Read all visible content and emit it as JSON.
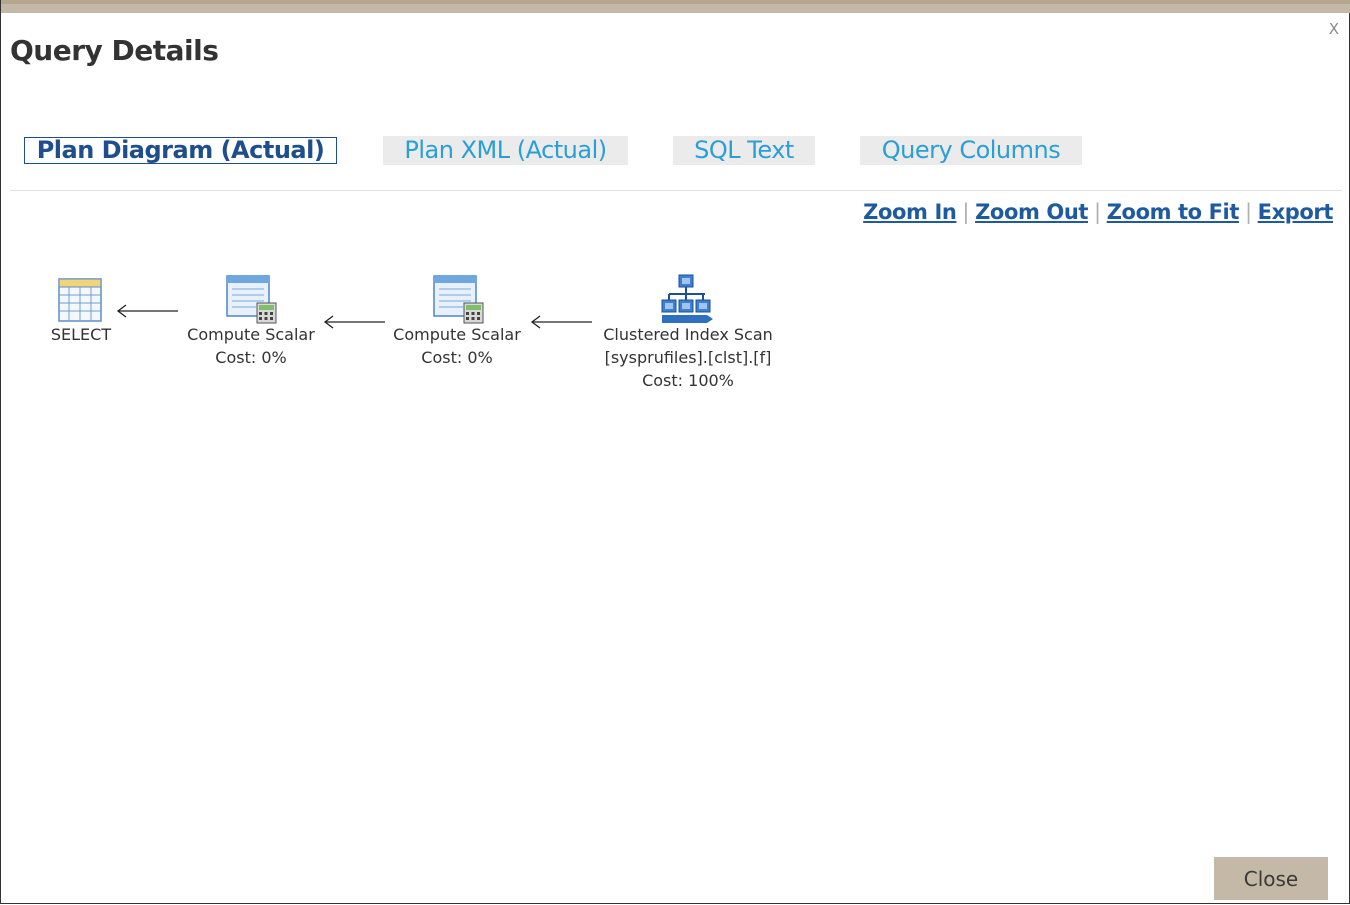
{
  "dialog": {
    "title": "Query Details",
    "close_glyph": "X",
    "close_button_label": "Close"
  },
  "tabs": [
    {
      "label": "Plan Diagram (Actual)",
      "active": true
    },
    {
      "label": "Plan XML (Actual)",
      "active": false
    },
    {
      "label": "SQL Text",
      "active": false
    },
    {
      "label": "Query Columns",
      "active": false
    }
  ],
  "zoom": {
    "zoom_in": "Zoom In",
    "zoom_out": "Zoom Out",
    "zoom_to_fit": "Zoom to Fit",
    "export": "Export",
    "separator": "|"
  },
  "plan_nodes": [
    {
      "icon": "select-table-icon",
      "name": "SELECT",
      "lines": []
    },
    {
      "icon": "compute-scalar-icon",
      "name": "Compute Scalar",
      "lines": [
        "Cost: 0%"
      ]
    },
    {
      "icon": "compute-scalar-icon",
      "name": "Compute Scalar",
      "lines": [
        "Cost: 0%"
      ]
    },
    {
      "icon": "clustered-index-scan-icon",
      "name": "Clustered Index Scan",
      "lines": [
        "[sysprufiles].[clst].[f]",
        "Cost: 100%"
      ]
    }
  ],
  "colors": {
    "header_bar": "#c3b9a6",
    "active_tab_text": "#1f4e8c",
    "inactive_tab_text": "#2a9fd6",
    "inactive_tab_bg": "#ebebeb",
    "link": "#1e5aa0",
    "close_button_bg": "#c3b9a6"
  }
}
